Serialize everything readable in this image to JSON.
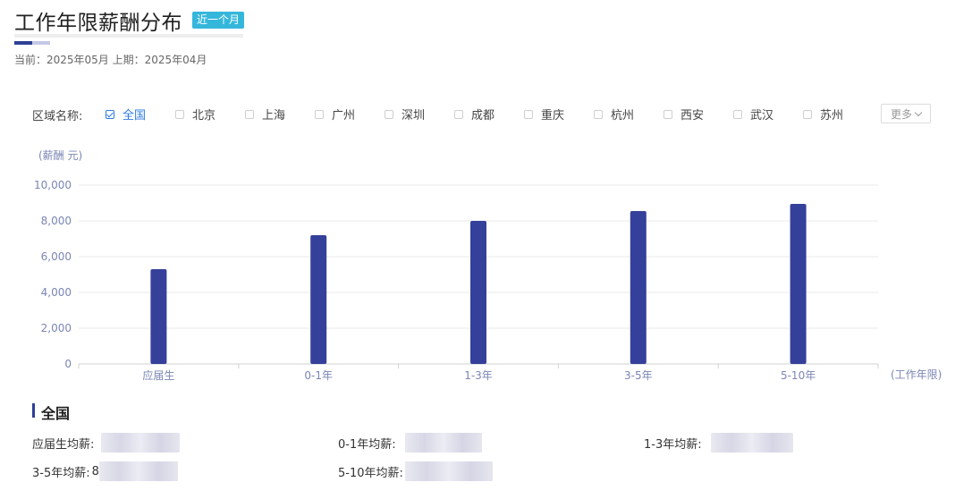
{
  "header": {
    "title": "工作年限薪酬分布",
    "badge": "近一个月",
    "period": "当前：2025年05月 上期：2025年04月"
  },
  "filter": {
    "label": "区域名称:",
    "regions": [
      {
        "name": "全国",
        "checked": true
      },
      {
        "name": "北京",
        "checked": false
      },
      {
        "name": "上海",
        "checked": false
      },
      {
        "name": "广州",
        "checked": false
      },
      {
        "name": "深圳",
        "checked": false
      },
      {
        "name": "成都",
        "checked": false
      },
      {
        "name": "重庆",
        "checked": false
      },
      {
        "name": "杭州",
        "checked": false
      },
      {
        "name": "西安",
        "checked": false
      },
      {
        "name": "武汉",
        "checked": false
      },
      {
        "name": "苏州",
        "checked": false
      }
    ],
    "more_label": "更多"
  },
  "chart_data": {
    "type": "bar",
    "ylabel": "(薪酬 元)",
    "xlabel": "(工作年限)",
    "categories": [
      "应届生",
      "0-1年",
      "1-3年",
      "3-5年",
      "5-10年"
    ],
    "values": [
      5300,
      7200,
      8000,
      8550,
      8950
    ],
    "ylim": [
      0,
      10000
    ],
    "yticks": [
      "0",
      "2,000",
      "4,000",
      "6,000",
      "8,000",
      "10,000"
    ],
    "grid": true,
    "bar_color": "#35409a"
  },
  "summary": {
    "title": "全国",
    "items": [
      {
        "label": "应届生均薪:",
        "prefix": ""
      },
      {
        "label": "0-1年均薪:",
        "prefix": ""
      },
      {
        "label": "1-3年均薪:",
        "prefix": ""
      },
      {
        "label": "3-5年均薪:",
        "prefix": "8"
      },
      {
        "label": "5-10年均薪:",
        "prefix": ""
      }
    ]
  }
}
